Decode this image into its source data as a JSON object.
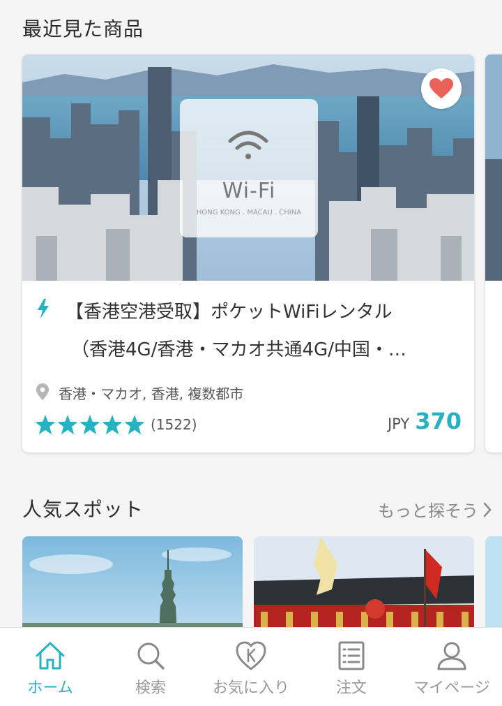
{
  "recent": {
    "title": "最近見た商品",
    "product": {
      "image_text_main": "Wi-Fi",
      "image_text_sub": "HONG KONG . MACAU . CHINA",
      "title_line1": "【香港空港受取】ポケットWiFiレンタル",
      "title_line2": "（香港4G/香港・マカオ共通4G/中国・…",
      "location": "香港・マカオ, 香港, 複数都市",
      "rating_stars": 5,
      "review_count": "(1522)",
      "currency": "JPY",
      "price": "370",
      "favorited": true
    }
  },
  "popular": {
    "title": "人気スポット",
    "more_label": "もっと探そう"
  },
  "nav": {
    "items": [
      {
        "label": "ホーム",
        "icon": "home-icon",
        "active": true
      },
      {
        "label": "検索",
        "icon": "search-icon",
        "active": false
      },
      {
        "label": "お気に入り",
        "icon": "favorites-icon",
        "active": false
      },
      {
        "label": "注文",
        "icon": "orders-icon",
        "active": false
      },
      {
        "label": "マイページ",
        "icon": "user-icon",
        "active": false
      }
    ]
  },
  "colors": {
    "accent": "#26b2c0",
    "heart": "#e8625a",
    "inactive": "#9a9a9a"
  }
}
